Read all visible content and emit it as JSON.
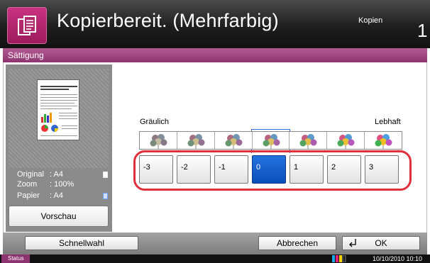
{
  "header": {
    "title": "Kopierbereit. (Mehrfarbig)",
    "kopien_label": "Kopien",
    "copy_count": "1",
    "app_icon": "copy-icon"
  },
  "section": {
    "title": "Sättigung"
  },
  "preview": {
    "original_label": "Original",
    "original_value": ": A4",
    "zoom_label": "Zoom",
    "zoom_value": ": 100%",
    "papier_label": "Papier",
    "papier_value": ": A4",
    "vorschau_label": "Vorschau"
  },
  "saturation": {
    "low_label": "Gräulich",
    "high_label": "Lebhaft",
    "options": [
      "-3",
      "-2",
      "-1",
      "0",
      "1",
      "2",
      "3"
    ],
    "selected": "0"
  },
  "footer": {
    "schnellwahl_label": "Schnellwahl",
    "abbrechen_label": "Abbrechen",
    "ok_label": "OK"
  },
  "status": {
    "status_label": "Status",
    "datetime": "10/10/2010  10:10"
  },
  "colors": {
    "accent": "#8d3470",
    "selected": "#0b4db9",
    "highlight_ring": "#e0303a"
  }
}
